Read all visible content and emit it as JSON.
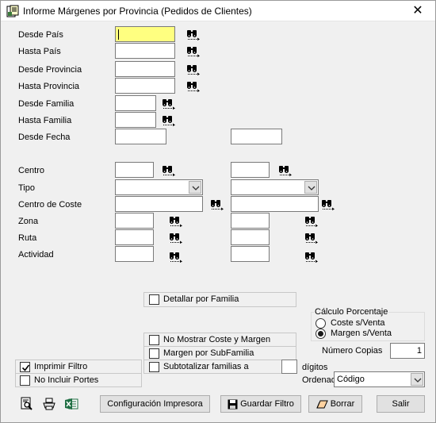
{
  "window": {
    "title": "Informe Márgenes por Provincia (Pedidos de Clientes)",
    "close_glyph": "✕"
  },
  "fields": {
    "desde_pais": "Desde País",
    "hasta_pais": "Hasta País",
    "desde_provincia": "Desde Provincia",
    "hasta_provincia": "Hasta Provincia",
    "desde_familia": "Desde Familia",
    "hasta_familia": "Hasta Familia",
    "desde_fecha": "Desde Fecha",
    "centro": "Centro",
    "tipo": "Tipo",
    "centro_coste": "Centro de Coste",
    "zona": "Zona",
    "ruta": "Ruta",
    "actividad": "Actividad"
  },
  "options": {
    "detallar_familia": {
      "label": "Detallar por Familia",
      "checked": false
    },
    "no_mostrar_coste": {
      "label": "No Mostrar Coste y Margen",
      "checked": false
    },
    "margen_subfamilia": {
      "label": "Margen por SubFamilia",
      "checked": false
    },
    "subtotalizar": {
      "label": "Subtotalizar familias a",
      "checked": false,
      "value": "",
      "suffix": "dígitos"
    },
    "imprimir_filtro": {
      "label": "Imprimir Filtro",
      "checked": true
    },
    "no_incluir_portes": {
      "label": "No Incluir Portes",
      "checked": false
    }
  },
  "calculo": {
    "title": "Cálculo Porcentaje",
    "options": [
      "Coste s/Venta",
      "Margen s/Venta"
    ],
    "selected": "Margen s/Venta"
  },
  "copias": {
    "label": "Número Copias",
    "value": "1"
  },
  "ordenado": {
    "label": "Ordenado",
    "value": "Código"
  },
  "toolbar": {
    "preview_icon": "print-preview-icon",
    "print_icon": "printer-icon",
    "excel_icon": "excel-export-icon"
  },
  "buttons": {
    "config_impresora": "Configuración Impresora",
    "guardar_filtro": "Guardar Filtro",
    "borrar": "Borrar",
    "salir": "Salir"
  }
}
